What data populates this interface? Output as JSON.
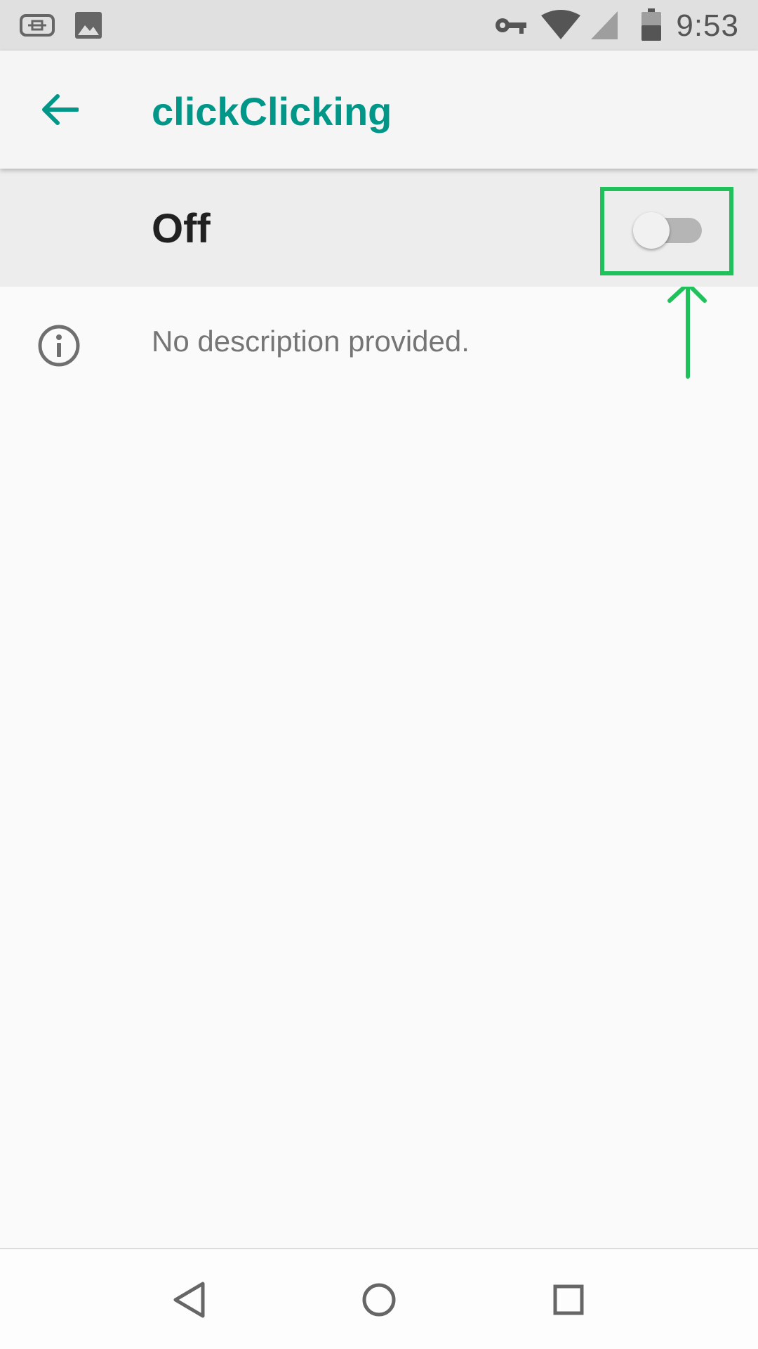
{
  "status_bar": {
    "time": "9:53",
    "icons": [
      "sd-card-icon",
      "image-icon",
      "vpn-key-icon",
      "wifi-icon",
      "cellular-signal-icon",
      "battery-icon"
    ]
  },
  "app_bar": {
    "title": "clickClicking",
    "back_icon": "arrow-back-icon",
    "title_color": "#009688"
  },
  "master_switch": {
    "label": "Off",
    "checked": false
  },
  "info": {
    "icon": "info-icon",
    "text": "No description provided."
  },
  "annotation": {
    "target": "toggle-switch",
    "color": "#1ec15a"
  },
  "nav_bar": {
    "buttons": [
      "back-triangle-icon",
      "home-circle-icon",
      "recents-square-icon"
    ]
  }
}
